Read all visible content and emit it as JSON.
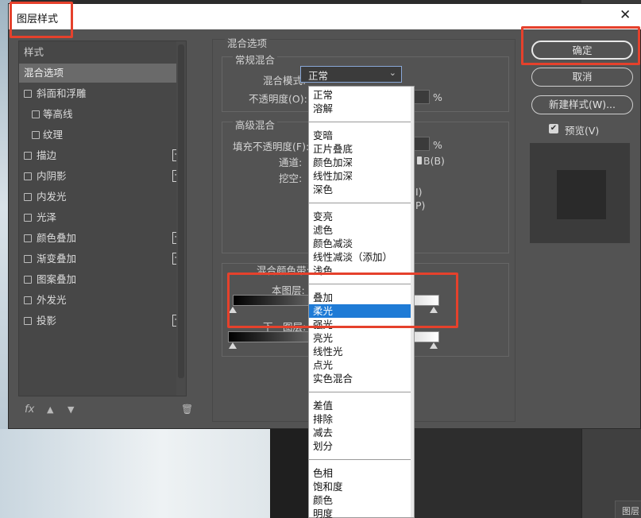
{
  "window": {
    "title": "图层样式"
  },
  "left_panel": {
    "header": "样式",
    "items": [
      {
        "label": "混合选项",
        "indent": 0,
        "selected": true,
        "checkbox": false,
        "plus": false
      },
      {
        "label": "斜面和浮雕",
        "indent": 0,
        "checkbox": true,
        "plus": false
      },
      {
        "label": "等高线",
        "indent": 1,
        "checkbox": true,
        "plus": false
      },
      {
        "label": "纹理",
        "indent": 1,
        "checkbox": true,
        "plus": false
      },
      {
        "label": "描边",
        "indent": 0,
        "checkbox": true,
        "plus": true
      },
      {
        "label": "内阴影",
        "indent": 0,
        "checkbox": true,
        "plus": true
      },
      {
        "label": "内发光",
        "indent": 0,
        "checkbox": true,
        "plus": false
      },
      {
        "label": "光泽",
        "indent": 0,
        "checkbox": true,
        "plus": false
      },
      {
        "label": "颜色叠加",
        "indent": 0,
        "checkbox": true,
        "plus": true
      },
      {
        "label": "渐变叠加",
        "indent": 0,
        "checkbox": true,
        "plus": true
      },
      {
        "label": "图案叠加",
        "indent": 0,
        "checkbox": true,
        "plus": false
      },
      {
        "label": "外发光",
        "indent": 0,
        "checkbox": true,
        "plus": false
      },
      {
        "label": "投影",
        "indent": 0,
        "checkbox": true,
        "plus": true
      }
    ],
    "fx_label": "fx"
  },
  "blending": {
    "section_title": "混合选项",
    "general": {
      "title": "常规混合",
      "mode_label": "混合模式:",
      "mode_value": "正常",
      "opacity_label": "不透明度(O):",
      "opacity_unit": "%"
    },
    "advanced": {
      "title": "高级混合",
      "fill_label": "填充不透明度(F):",
      "fill_unit": "%",
      "channels_label": "通道:",
      "channel_b": "B(B)",
      "knockout_label": "挖空:",
      "partial_i": "I)",
      "partial_p": "P)"
    },
    "blend_if": {
      "label": "混合颜色带:",
      "this_layer": "本图层:",
      "underlying": "下一图层:"
    }
  },
  "dropdown": {
    "groups": [
      [
        "正常",
        "溶解"
      ],
      [
        "变暗",
        "正片叠底",
        "颜色加深",
        "线性加深",
        "深色"
      ],
      [
        "变亮",
        "滤色",
        "颜色减淡",
        "线性减淡（添加）",
        "浅色"
      ],
      [
        "叠加",
        "柔光",
        "强光",
        "亮光",
        "线性光",
        "点光",
        "实色混合"
      ],
      [
        "差值",
        "排除",
        "减去",
        "划分"
      ],
      [
        "色相",
        "饱和度",
        "颜色",
        "明度"
      ]
    ],
    "selected": "柔光"
  },
  "buttons": {
    "ok": "确定",
    "cancel": "取消",
    "new_style": "新建样式(W)...",
    "preview": "预览(V)",
    "preview_checked": true
  },
  "background": {
    "panel_tab": "图层"
  },
  "colors": {
    "highlight": "#e5412c",
    "selection": "#1f7bd6",
    "dialog_bg": "#535353"
  }
}
